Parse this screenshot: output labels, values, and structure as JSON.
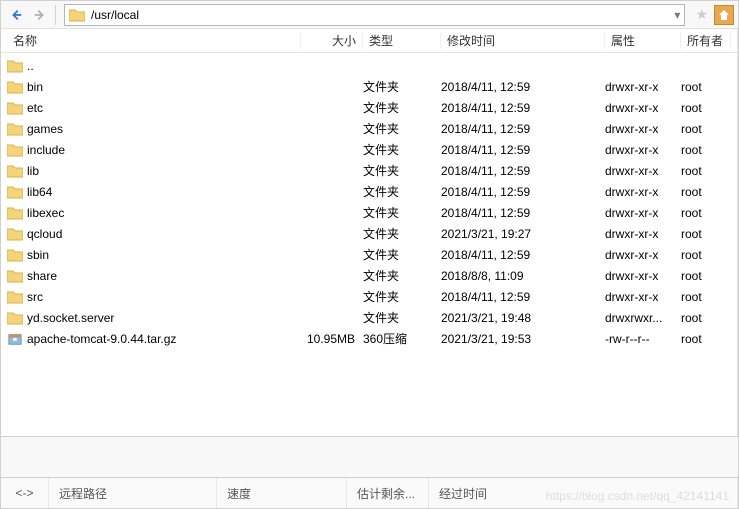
{
  "toolbar": {
    "path": "/usr/local"
  },
  "columns": {
    "name": "名称",
    "size": "大小",
    "type": "类型",
    "date": "修改时间",
    "attr": "属性",
    "owner": "所有者"
  },
  "parent_dir": "..",
  "files": [
    {
      "icon": "folder",
      "name": "bin",
      "size": "",
      "type": "文件夹",
      "date": "2018/4/11, 12:59",
      "attr": "drwxr-xr-x",
      "owner": "root"
    },
    {
      "icon": "folder",
      "name": "etc",
      "size": "",
      "type": "文件夹",
      "date": "2018/4/11, 12:59",
      "attr": "drwxr-xr-x",
      "owner": "root"
    },
    {
      "icon": "folder",
      "name": "games",
      "size": "",
      "type": "文件夹",
      "date": "2018/4/11, 12:59",
      "attr": "drwxr-xr-x",
      "owner": "root"
    },
    {
      "icon": "folder",
      "name": "include",
      "size": "",
      "type": "文件夹",
      "date": "2018/4/11, 12:59",
      "attr": "drwxr-xr-x",
      "owner": "root"
    },
    {
      "icon": "folder",
      "name": "lib",
      "size": "",
      "type": "文件夹",
      "date": "2018/4/11, 12:59",
      "attr": "drwxr-xr-x",
      "owner": "root"
    },
    {
      "icon": "folder",
      "name": "lib64",
      "size": "",
      "type": "文件夹",
      "date": "2018/4/11, 12:59",
      "attr": "drwxr-xr-x",
      "owner": "root"
    },
    {
      "icon": "folder",
      "name": "libexec",
      "size": "",
      "type": "文件夹",
      "date": "2018/4/11, 12:59",
      "attr": "drwxr-xr-x",
      "owner": "root"
    },
    {
      "icon": "folder",
      "name": "qcloud",
      "size": "",
      "type": "文件夹",
      "date": "2021/3/21, 19:27",
      "attr": "drwxr-xr-x",
      "owner": "root"
    },
    {
      "icon": "folder",
      "name": "sbin",
      "size": "",
      "type": "文件夹",
      "date": "2018/4/11, 12:59",
      "attr": "drwxr-xr-x",
      "owner": "root"
    },
    {
      "icon": "folder",
      "name": "share",
      "size": "",
      "type": "文件夹",
      "date": "2018/8/8, 11:09",
      "attr": "drwxr-xr-x",
      "owner": "root"
    },
    {
      "icon": "folder",
      "name": "src",
      "size": "",
      "type": "文件夹",
      "date": "2018/4/11, 12:59",
      "attr": "drwxr-xr-x",
      "owner": "root"
    },
    {
      "icon": "folder",
      "name": "yd.socket.server",
      "size": "",
      "type": "文件夹",
      "date": "2021/3/21, 19:48",
      "attr": "drwxrwxr...",
      "owner": "root"
    },
    {
      "icon": "archive",
      "name": "apache-tomcat-9.0.44.tar.gz",
      "size": "10.95MB",
      "type": "360压缩",
      "date": "2021/3/21, 19:53",
      "attr": "-rw-r--r--",
      "owner": "root"
    }
  ],
  "status": {
    "nav": "<->",
    "remote": "远程路径",
    "speed": "速度",
    "est": "估计剩余...",
    "elapsed": "经过时间"
  },
  "watermark": "https://blog.csdn.net/qq_42141141"
}
